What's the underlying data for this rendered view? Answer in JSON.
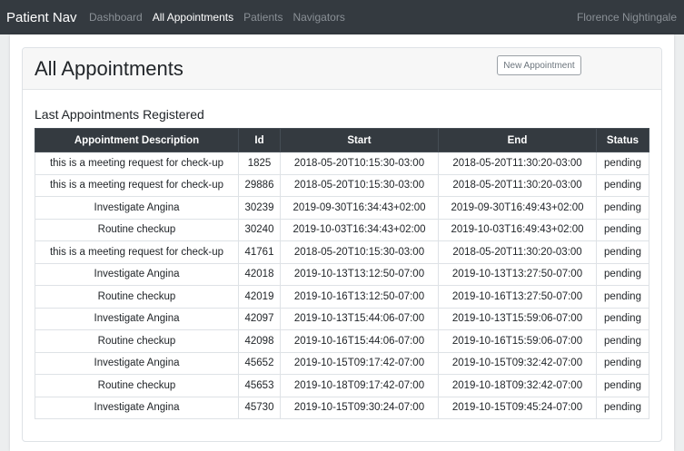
{
  "navbar": {
    "brand": "Patient Nav",
    "links": [
      {
        "label": "Dashboard",
        "active": false
      },
      {
        "label": "All Appointments",
        "active": true
      },
      {
        "label": "Patients",
        "active": false
      },
      {
        "label": "Navigators",
        "active": false
      }
    ],
    "user": "Florence Nightingale"
  },
  "page": {
    "title": "All Appointments",
    "new_button": "New Appointment",
    "section_title": "Last Appointments Registered"
  },
  "table": {
    "headers": [
      "Appointment Description",
      "Id",
      "Start",
      "End",
      "Status"
    ],
    "rows": [
      [
        "this is a meeting request for check-up",
        "1825",
        "2018-05-20T10:15:30-03:00",
        "2018-05-20T11:30:20-03:00",
        "pending"
      ],
      [
        "this is a meeting request for check-up",
        "29886",
        "2018-05-20T10:15:30-03:00",
        "2018-05-20T11:30:20-03:00",
        "pending"
      ],
      [
        "Investigate Angina",
        "30239",
        "2019-09-30T16:34:43+02:00",
        "2019-09-30T16:49:43+02:00",
        "pending"
      ],
      [
        "Routine checkup",
        "30240",
        "2019-10-03T16:34:43+02:00",
        "2019-10-03T16:49:43+02:00",
        "pending"
      ],
      [
        "this is a meeting request for check-up",
        "41761",
        "2018-05-20T10:15:30-03:00",
        "2018-05-20T11:30:20-03:00",
        "pending"
      ],
      [
        "Investigate Angina",
        "42018",
        "2019-10-13T13:12:50-07:00",
        "2019-10-13T13:27:50-07:00",
        "pending"
      ],
      [
        "Routine checkup",
        "42019",
        "2019-10-16T13:12:50-07:00",
        "2019-10-16T13:27:50-07:00",
        "pending"
      ],
      [
        "Investigate Angina",
        "42097",
        "2019-10-13T15:44:06-07:00",
        "2019-10-13T15:59:06-07:00",
        "pending"
      ],
      [
        "Routine checkup",
        "42098",
        "2019-10-16T15:44:06-07:00",
        "2019-10-16T15:59:06-07:00",
        "pending"
      ],
      [
        "Investigate Angina",
        "45652",
        "2019-10-15T09:17:42-07:00",
        "2019-10-15T09:32:42-07:00",
        "pending"
      ],
      [
        "Routine checkup",
        "45653",
        "2019-10-18T09:17:42-07:00",
        "2019-10-18T09:32:42-07:00",
        "pending"
      ],
      [
        "Investigate Angina",
        "45730",
        "2019-10-15T09:30:24-07:00",
        "2019-10-15T09:45:24-07:00",
        "pending"
      ]
    ]
  }
}
